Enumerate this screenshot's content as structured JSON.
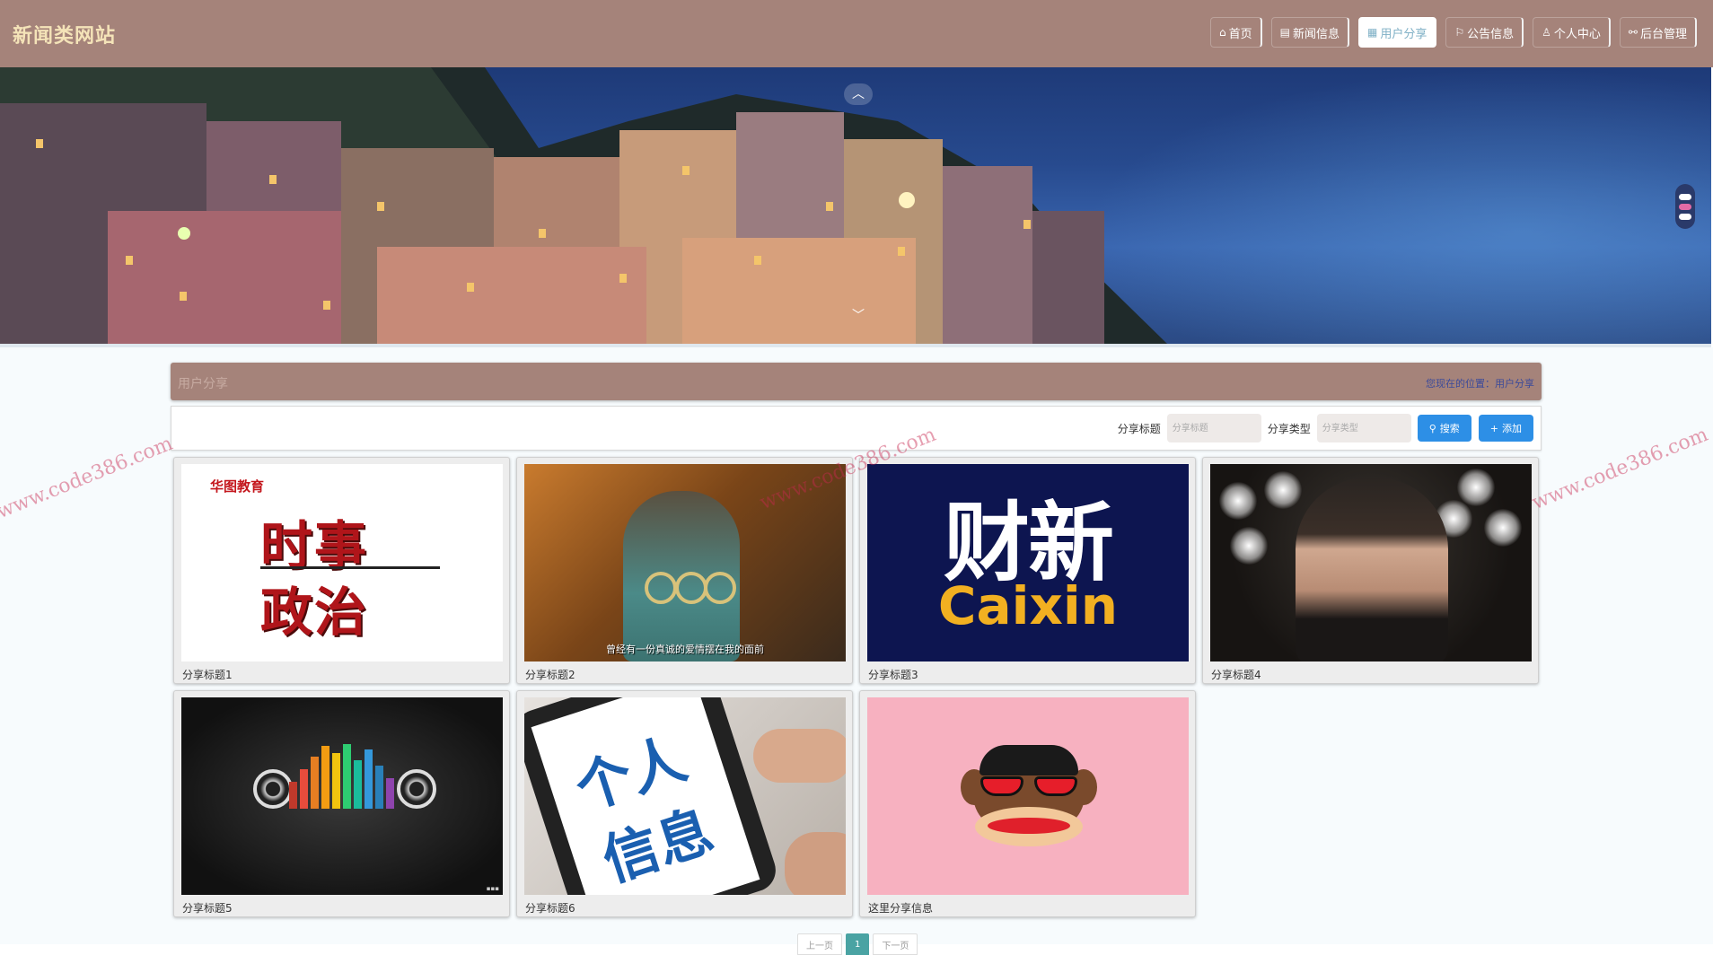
{
  "site": {
    "title": "新闻类网站"
  },
  "nav": [
    {
      "label": "首页",
      "icon": "home-icon",
      "glyph": "⌂",
      "active": false
    },
    {
      "label": "新闻信息",
      "icon": "newspaper-icon",
      "glyph": "▤",
      "active": false
    },
    {
      "label": "用户分享",
      "icon": "share-icon",
      "glyph": "▦",
      "active": true
    },
    {
      "label": "公告信息",
      "icon": "flag-icon",
      "glyph": "⚐",
      "active": false
    },
    {
      "label": "个人中心",
      "icon": "user-icon",
      "glyph": "♙",
      "active": false
    },
    {
      "label": "后台管理",
      "icon": "link-icon",
      "glyph": "⚯",
      "active": false
    }
  ],
  "banner": {
    "up_glyph": "︿",
    "down_glyph": "﹀"
  },
  "section": {
    "title": "用户分享",
    "breadcrumb": "您现在的位置：用户分享"
  },
  "search": {
    "title_label": "分享标题",
    "title_placeholder": "分享标题",
    "type_label": "分享类型",
    "type_placeholder": "分享类型",
    "search_button": "搜索",
    "add_button": "添加",
    "search_icon": "⚲",
    "add_icon": "+"
  },
  "cards": [
    {
      "label": "分享标题1",
      "img_text_1": "时事",
      "img_text_2": "政治",
      "img_logo": "华图教育"
    },
    {
      "label": "分享标题2",
      "img_caption": "曾经有一份真诚的爱情摆在我的面前"
    },
    {
      "label": "分享标题3",
      "img_cn": "财新",
      "img_en": "Caixin"
    },
    {
      "label": "分享标题4"
    },
    {
      "label": "分享标题5"
    },
    {
      "label": "分享标题6",
      "img_text_1": "个人",
      "img_text_2": "信息"
    },
    {
      "label": "这里分享信息"
    }
  ],
  "watermark": "www.code386.com",
  "pagination": {
    "prev": "上一页",
    "current": "1",
    "next": "下一页"
  }
}
